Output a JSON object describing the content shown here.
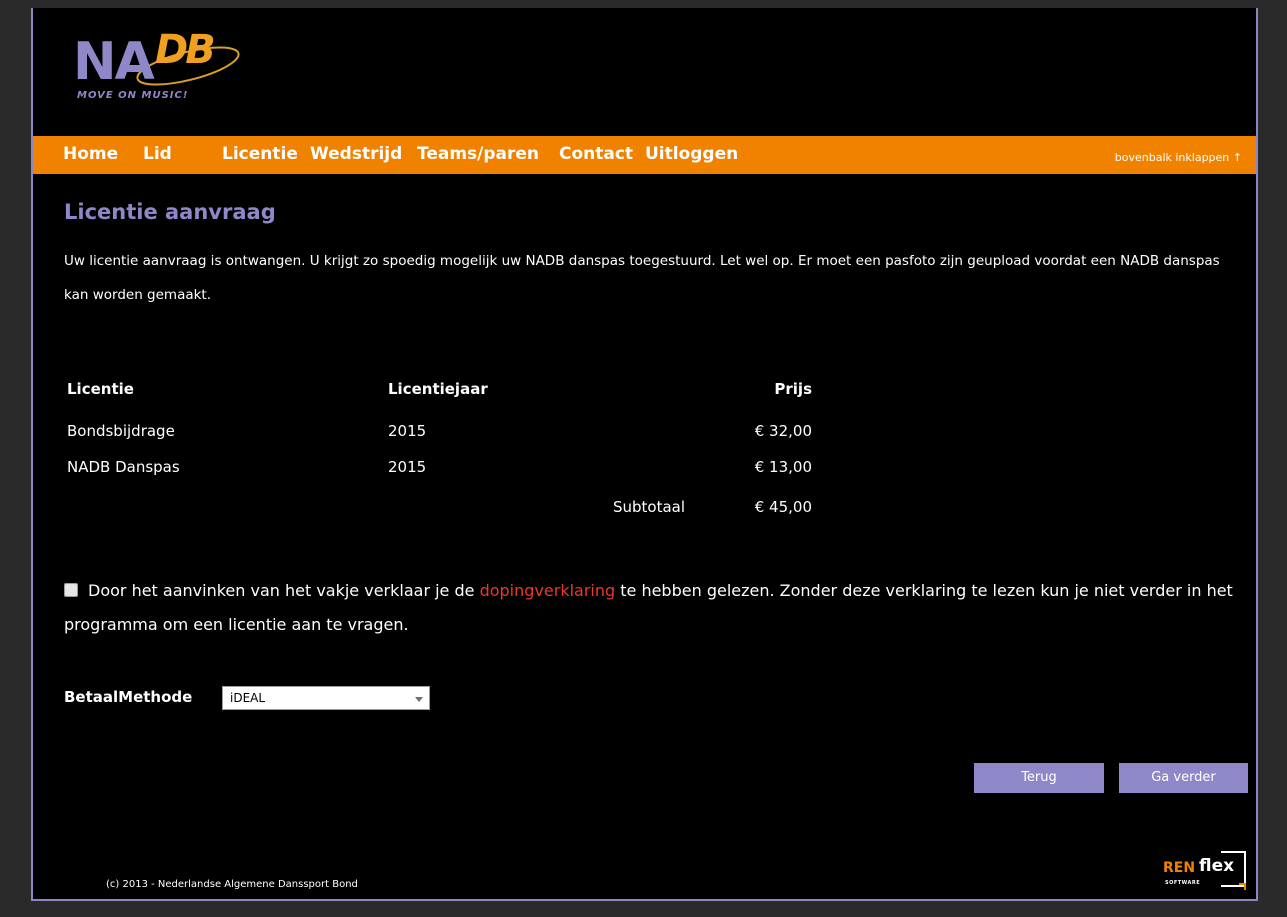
{
  "brand": {
    "logo_left": "NA",
    "logo_right": "DB",
    "tagline": "MOVE ON MUSIC!",
    "colors": {
      "purple": "#8f88c8",
      "orange": "#f08200",
      "link_red": "#e83a2a"
    }
  },
  "nav": {
    "items": [
      {
        "label": "Home"
      },
      {
        "label": "Lid"
      },
      {
        "label": "Licentie"
      },
      {
        "label": "Wedstrijd"
      },
      {
        "label": "Teams/paren"
      },
      {
        "label": "Contact"
      },
      {
        "label": "Uitloggen"
      }
    ],
    "collapse": "bovenbalk inklappen ↑"
  },
  "page": {
    "title": "Licentie aanvraag",
    "intro": "Uw licentie aanvraag is ontwangen. U krijgt zo spoedig mogelijk uw NADB danspas toegestuurd. Let wel op. Er moet een pasfoto zijn geupload voordat een NADB danspas kan worden gemaakt."
  },
  "table": {
    "headers": {
      "license": "Licentie",
      "year": "Licentiejaar",
      "price": "Prijs"
    },
    "rows": [
      {
        "license": "Bondsbijdrage",
        "year": "2015",
        "price": "€ 32,00"
      },
      {
        "license": "NADB Danspas",
        "year": "2015",
        "price": "€ 13,00"
      }
    ],
    "subtotal_label": "Subtotaal",
    "subtotal_value": "€ 45,00"
  },
  "declaration": {
    "checked": false,
    "text_before": "Door het aanvinken van het vakje verklaar je de ",
    "link": "dopingverklaring",
    "text_after": " te hebben gelezen. Zonder deze verklaring te lezen kun je niet verder in het programma om een licentie aan te vragen."
  },
  "payment": {
    "label": "BetaalMethode",
    "selected": "iDEAL"
  },
  "buttons": {
    "back": "Terug",
    "next": "Ga verder"
  },
  "footer": {
    "copyright": "(c) 2013 - Nederlandse Algemene Danssport Bond",
    "vendor_ren": "REN",
    "vendor_flex": "flex",
    "vendor_sub": "SOFTWARE"
  }
}
